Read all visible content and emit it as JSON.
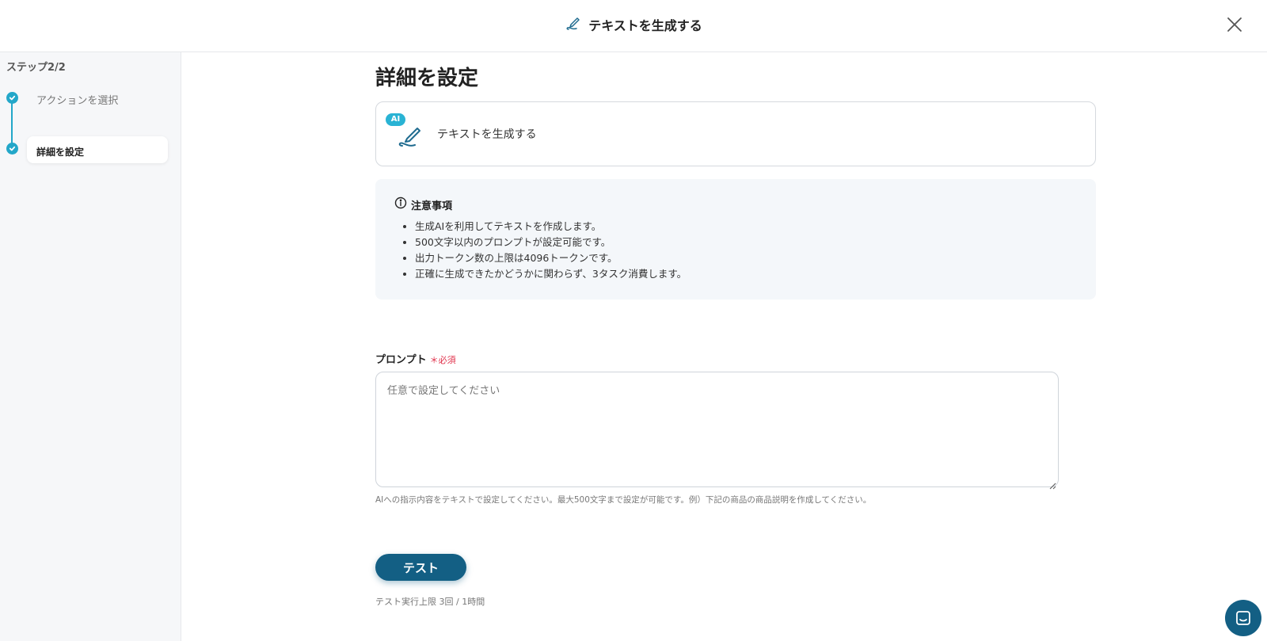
{
  "header": {
    "title": "テキストを生成する",
    "icon": "pen-icon",
    "close_icon": "close-icon"
  },
  "sidebar": {
    "step_count": "ステップ2/2",
    "steps": [
      {
        "label": "アクションを選択",
        "state": "done"
      },
      {
        "label": "詳細を設定",
        "state": "active"
      }
    ]
  },
  "main": {
    "page_title": "詳細を設定",
    "action_card": {
      "badge": "AI",
      "label": "テキストを生成する"
    },
    "notice": {
      "title": "注意事項",
      "items": [
        "生成AIを利用してテキストを作成します。",
        "500文字以内のプロンプトが設定可能です。",
        "出力トークン数の上限は4096トークンです。",
        "正確に生成できたかどうかに関わらず、3タスク消費します。"
      ]
    },
    "prompt": {
      "label": "プロンプト",
      "required": "＊必須",
      "placeholder": "任意で設定してください",
      "value": "",
      "help": "AIへの指示内容をテキストで設定してください。最大500文字まで設定が可能です。例）下記の商品の商品説明を作成してください。"
    },
    "test_button": "テスト",
    "test_limit": "テスト実行上限 3回 / 1時間"
  },
  "colors": {
    "accent": "#23a7c9",
    "primary": "#135f84",
    "required": "#e0314b"
  }
}
